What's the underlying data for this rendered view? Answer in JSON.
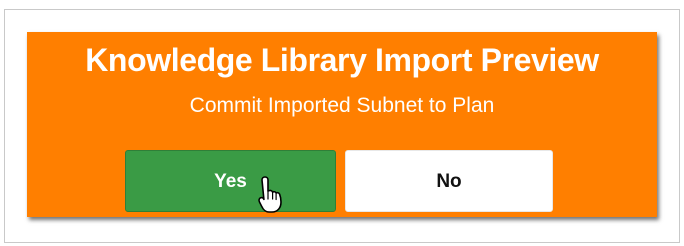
{
  "dialog": {
    "title": "Knowledge Library Import Preview",
    "subtitle": "Commit Imported Subnet to Plan",
    "yes_label": "Yes",
    "no_label": "No"
  },
  "colors": {
    "dialog_background": "#ff7f00",
    "yes_button": "#3a9b45",
    "no_button": "#ffffff",
    "text_on_orange": "#ffffff"
  },
  "icons": {
    "cursor": "hand-pointer-icon"
  }
}
